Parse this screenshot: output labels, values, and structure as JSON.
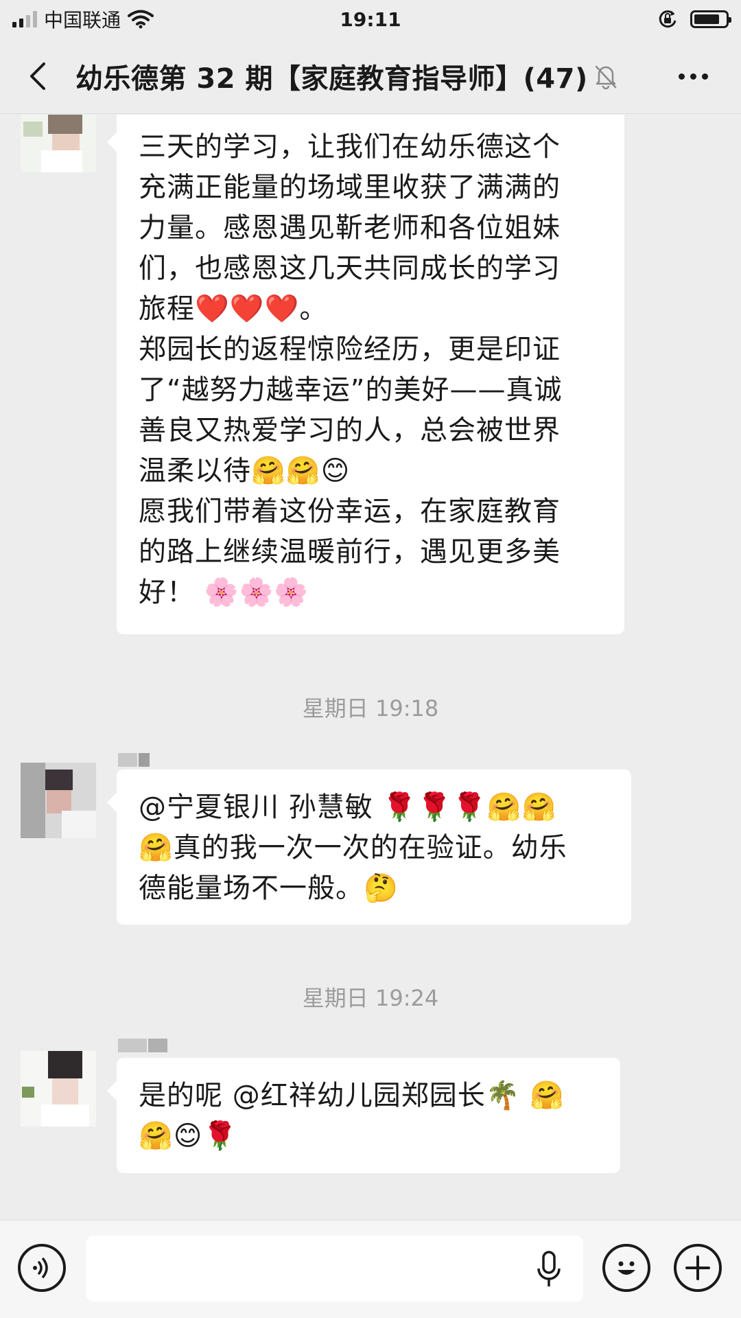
{
  "status_bar": {
    "carrier": "中国联通",
    "time": "19:11"
  },
  "header": {
    "title": "幼乐德第 32 期【家庭教育指导师】(47)"
  },
  "messages": [
    {
      "type": "text",
      "text": "三天的学习，让我们在幼乐德这个\n充满正能量的场域里收获了满满的\n力量。感恩遇见靳老师和各位姐妹\n们，也感恩这几天共同成长的学习\n旅程❤️❤️❤️。\n郑园长的返程惊险经历，更是印证\n了“越努力越幸运”的美好——真诚\n善良又热爱学习的人，总会被世界\n温柔以待🤗🤗😊\n愿我们带着这份幸运，在家庭教育\n的路上继续温暖前行，遇见更多美\n好！ 🌸🌸🌸"
    },
    {
      "type": "time",
      "text": "星期日 19:18"
    },
    {
      "type": "text",
      "text": "@宁夏银川 孙慧敏 🌹🌹🌹🤗🤗\n🤗真的我一次一次的在验证。幼乐\n德能量场不一般。🤔"
    },
    {
      "type": "time",
      "text": "星期日 19:24"
    },
    {
      "type": "text",
      "text": "是的呢 @红祥幼儿园郑园长🌴 🤗\n🤗😊🌹"
    }
  ],
  "input_bar": {
    "placeholder": ""
  },
  "icons": {
    "back": "chevron-left-icon",
    "mute": "bell-off-icon",
    "more": "more-dots-icon",
    "voice": "voice-icon",
    "mic": "microphone-icon",
    "emoji": "emoji-icon",
    "plus": "plus-icon"
  },
  "colors": {
    "background": "#ededed",
    "bubble": "#ffffff",
    "time_text": "#9b9b9b"
  }
}
